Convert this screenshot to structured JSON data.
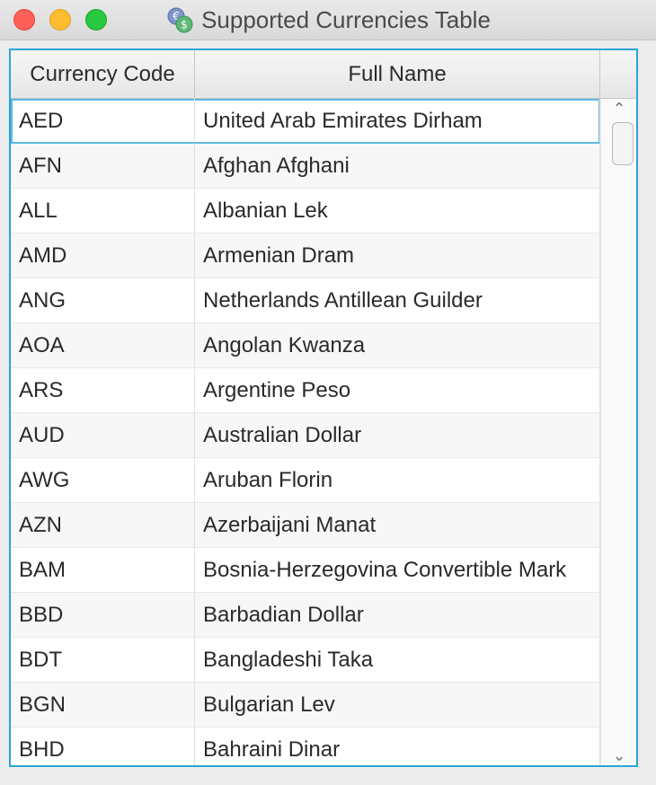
{
  "window": {
    "title": "Supported Currencies Table",
    "icon": "currency-exchange-icon"
  },
  "table": {
    "columns": [
      "Currency Code",
      "Full Name"
    ],
    "rows": [
      {
        "code": "AED",
        "name": "United Arab Emirates Dirham"
      },
      {
        "code": "AFN",
        "name": "Afghan Afghani"
      },
      {
        "code": "ALL",
        "name": "Albanian Lek"
      },
      {
        "code": "AMD",
        "name": "Armenian Dram"
      },
      {
        "code": "ANG",
        "name": "Netherlands Antillean Guilder"
      },
      {
        "code": "AOA",
        "name": "Angolan Kwanza"
      },
      {
        "code": "ARS",
        "name": "Argentine Peso"
      },
      {
        "code": "AUD",
        "name": "Australian Dollar"
      },
      {
        "code": "AWG",
        "name": "Aruban Florin"
      },
      {
        "code": "AZN",
        "name": "Azerbaijani Manat"
      },
      {
        "code": "BAM",
        "name": "Bosnia-Herzegovina Convertible Mark"
      },
      {
        "code": "BBD",
        "name": "Barbadian Dollar"
      },
      {
        "code": "BDT",
        "name": "Bangladeshi Taka"
      },
      {
        "code": "BGN",
        "name": "Bulgarian Lev"
      },
      {
        "code": "BHD",
        "name": "Bahraini Dinar"
      }
    ],
    "selected_row": 0
  },
  "colors": {
    "accent": "#2aa4d8",
    "close": "#fe5f57",
    "minimize": "#febc2e",
    "maximize": "#28c840"
  }
}
